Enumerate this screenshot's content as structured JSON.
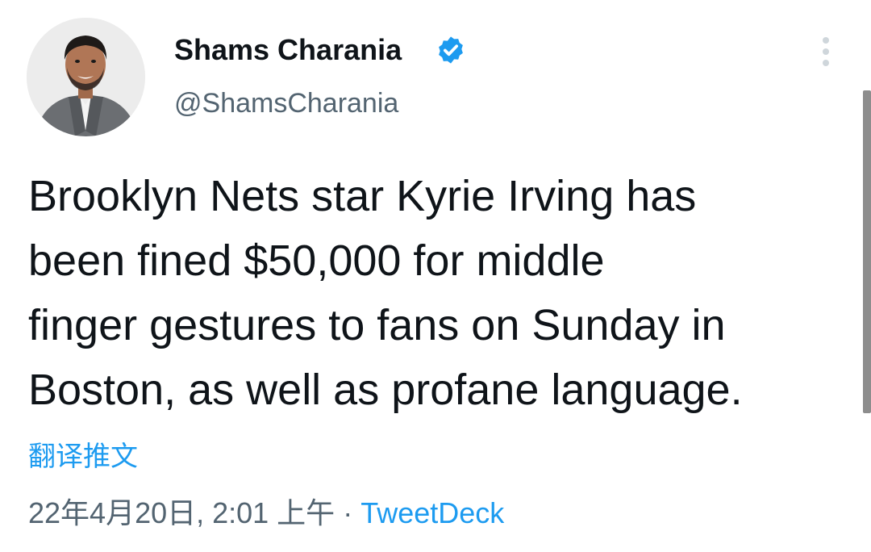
{
  "author": {
    "display_name": "Shams Charania",
    "handle": "@ShamsCharania",
    "verified": true
  },
  "tweet": {
    "lines": [
      "Brooklyn Nets star Kyrie Irving has",
      "been fined $50,000 for middle",
      "finger gestures to fans on Sunday in",
      "Boston, as well as profane language."
    ]
  },
  "translate_label": "翻译推文",
  "meta": {
    "timestamp": "22年4月20日, 2:01 上午",
    "separator": "·",
    "source": "TweetDeck"
  },
  "icons": {
    "verified": "verified-badge-icon",
    "more": "more-vertical-icon"
  },
  "colors": {
    "link": "#1d9bf0",
    "secondary_text": "#536471",
    "primary_text": "#0f1419"
  }
}
